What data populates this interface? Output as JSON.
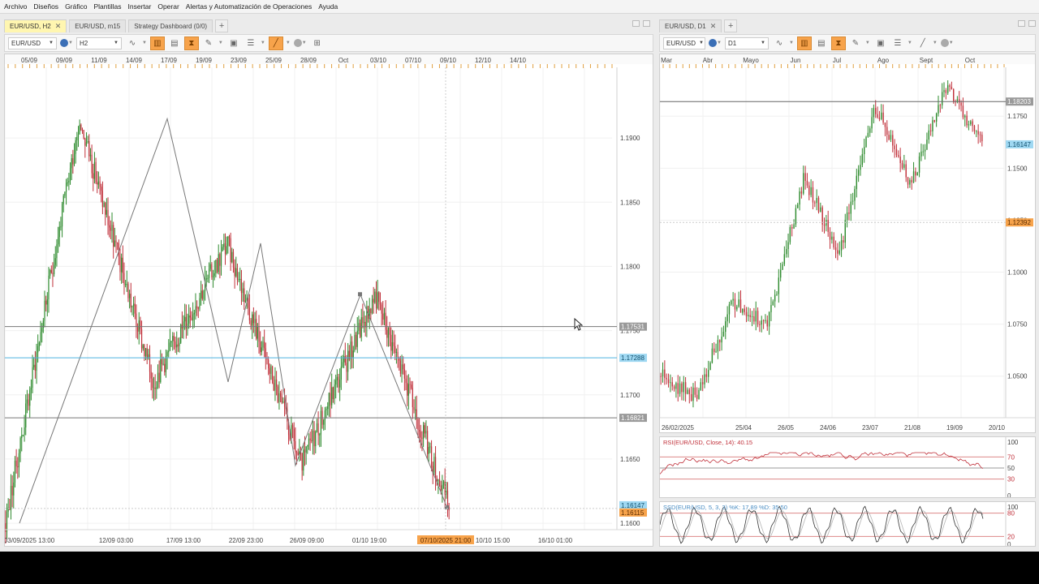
{
  "menu": [
    "Archivo",
    "Diseños",
    "Gráfico",
    "Plantillas",
    "Insertar",
    "Operar",
    "Alertas y Automatización de Operaciones",
    "Ayuda"
  ],
  "left": {
    "tabs": [
      {
        "label": "EUR/USD, H2",
        "active": true,
        "closable": true
      },
      {
        "label": "EUR/USD, m15",
        "active": false,
        "closable": false
      },
      {
        "label": "Strategy Dashboard (0/0)",
        "active": false,
        "closable": false
      }
    ],
    "tab_add": "+",
    "symbol": "EUR/USD",
    "timeframe": "H2",
    "top_dates": [
      "05/09",
      "09/09",
      "11/09",
      "14/09",
      "17/09",
      "19/09",
      "23/09",
      "25/09",
      "28/09",
      "Oct",
      "03/10",
      "07/10",
      "09/10",
      "12/10",
      "14/10"
    ],
    "bottom_dates": [
      "03/09/2025 13:00",
      "12/09 03:00",
      "17/09 13:00",
      "22/09 23:00",
      "26/09 09:00",
      "01/10 19:00",
      "10/10 15:00",
      "16/10 01:00"
    ],
    "crosshair_date": "07/10/2025 21:00",
    "price_ticks": [
      "1.1900",
      "1.1850",
      "1.1800",
      "1.1750",
      "1.1700",
      "1.1650",
      "1.1600"
    ],
    "level_labels": {
      "upper": "1.17531",
      "blue": "1.17288",
      "lower": "1.16821",
      "current": "1.16115",
      "prev": "1.16147"
    },
    "chart_data": {
      "type": "line",
      "title": "EUR/USD, H2",
      "ylim": [
        1.1595,
        1.1955
      ],
      "x_range": [
        "03/09/2025 13:00",
        "16/10 01:00"
      ],
      "horizontal_levels": [
        1.17531,
        1.17288,
        1.16821,
        1.16115
      ],
      "swing_points": [
        {
          "x": "05/09",
          "y": 1.16
        },
        {
          "x": "17/09 13:00",
          "y": 1.1915
        },
        {
          "x": "22/09 23:00",
          "y": 1.171
        },
        {
          "x": "24/09",
          "y": 1.1818
        },
        {
          "x": "26/09 09:00",
          "y": 1.1645
        },
        {
          "x": "01/10 19:00",
          "y": 1.1778
        },
        {
          "x": "07/10/2025 21:00",
          "y": 1.1612
        }
      ]
    }
  },
  "right": {
    "tabs": [
      {
        "label": "EUR/USD, D1",
        "active": false,
        "closable": true
      }
    ],
    "tab_add": "+",
    "symbol": "EUR/USD",
    "timeframe": "D1",
    "top_months": [
      "Mar",
      "Abr",
      "Mayo",
      "Jun",
      "Jul",
      "Ago",
      "Sept",
      "Oct"
    ],
    "bottom_dates": [
      "26/02/2025",
      "25/04",
      "26/05",
      "24/06",
      "23/07",
      "21/08",
      "19/09",
      "20/10"
    ],
    "price_ticks": [
      "1.1750",
      "1.1500",
      "1.1250",
      "1.1000",
      "1.0750",
      "1.0500"
    ],
    "level_labels": {
      "upper": "1.18203",
      "current": "1.16147",
      "orange": "1.12392"
    },
    "chart_data": {
      "type": "line",
      "title": "EUR/USD, D1",
      "ylim": [
        1.03,
        1.1985
      ],
      "x_range": [
        "26/02/2025",
        "20/10"
      ],
      "horizontal_levels": [
        1.18203,
        1.12392
      ],
      "swing_points": [
        {
          "x": "26/02/2025",
          "y": 1.05
        },
        {
          "x": "01/03",
          "y": 1.04
        },
        {
          "x": "10/03",
          "y": 1.085
        },
        {
          "x": "25/03",
          "y": 1.075
        },
        {
          "x": "21/04",
          "y": 1.145
        },
        {
          "x": "12/05",
          "y": 1.11
        },
        {
          "x": "01/07",
          "y": 1.18
        },
        {
          "x": "01/08",
          "y": 1.142
        },
        {
          "x": "17/09",
          "y": 1.19
        },
        {
          "x": "10/10",
          "y": 1.1615
        }
      ]
    },
    "rsi": {
      "label": "RSI(EUR/USD, Close, 14): 40.15",
      "levels": [
        "100",
        "70",
        "50",
        "30",
        "0"
      ]
    },
    "stoch": {
      "label": "SSD(EUR/USD, 5, 3, 3)  %K: 17.89  %D: 35.50",
      "levels": [
        "100",
        "80",
        "20",
        "0"
      ]
    }
  },
  "colors": {
    "up": "#2e8b2e",
    "down": "#c0303a",
    "accent": "#f7a34b",
    "blue_level": "#4fb3e0",
    "active_tab": "#fff6b0"
  }
}
